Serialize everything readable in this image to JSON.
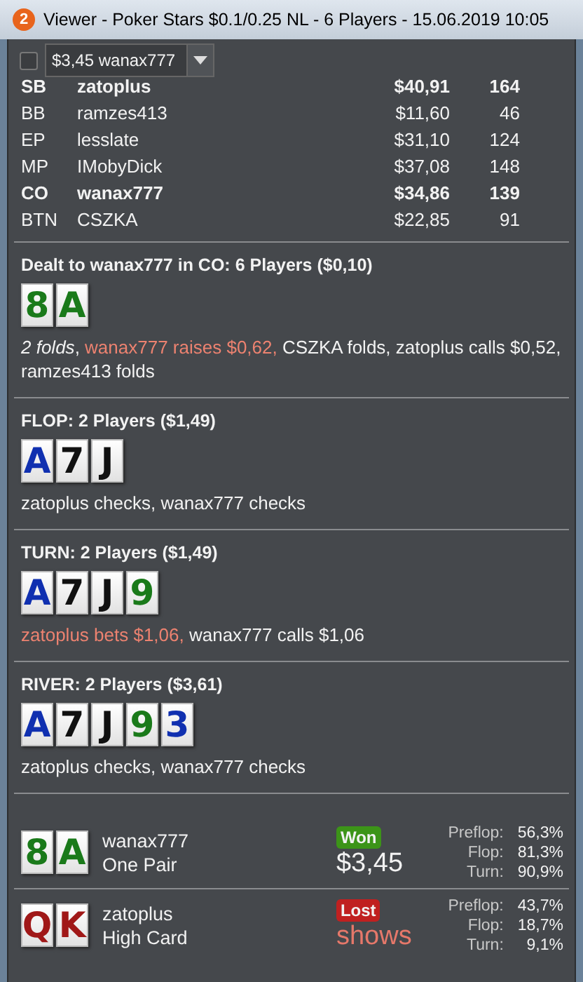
{
  "window": {
    "badge": "2",
    "title": "Viewer - Poker Stars $0.1/0.25 NL - 6 Players - 15.06.2019 10:05"
  },
  "toolbar": {
    "checkbox": {
      "checked": false
    },
    "dropdown": {
      "value": "$3,45 wanax777"
    }
  },
  "players": [
    {
      "position": "SB",
      "name": "zatoplus",
      "stack": "$40,91",
      "bb": "164",
      "highlighted": true
    },
    {
      "position": "BB",
      "name": "ramzes413",
      "stack": "$11,60",
      "bb": "46",
      "highlighted": false
    },
    {
      "position": "EP",
      "name": "lesslate",
      "stack": "$31,10",
      "bb": "124",
      "highlighted": false
    },
    {
      "position": "MP",
      "name": "IMobyDick",
      "stack": "$37,08",
      "bb": "148",
      "highlighted": false
    },
    {
      "position": "CO",
      "name": "wanax777",
      "stack": "$34,86",
      "bb": "139",
      "highlighted": true
    },
    {
      "position": "BTN",
      "name": "CSZKA",
      "stack": "$22,85",
      "bb": "91",
      "highlighted": false
    }
  ],
  "streets": [
    {
      "title": "Dealt to wanax777 in CO: 6 Players ($0,10)",
      "cards": [
        {
          "rank": "8",
          "color": "#1a7a1a"
        },
        {
          "rank": "A",
          "color": "#1a7a1a"
        }
      ],
      "actions": [
        {
          "kind": "folds",
          "text": "2 folds"
        },
        {
          "kind": "plain",
          "text": ", "
        },
        {
          "kind": "aggressive",
          "text": "wanax777 raises $0,62,"
        },
        {
          "kind": "plain",
          "text": " CSZKA folds, zatoplus calls $0,52, ramzes413 folds"
        }
      ]
    },
    {
      "title": "FLOP: 2 Players ($1,49)",
      "cards": [
        {
          "rank": "A",
          "color": "#1030b0"
        },
        {
          "rank": "7",
          "color": "#111111"
        },
        {
          "rank": "J",
          "color": "#111111"
        }
      ],
      "actions": [
        {
          "kind": "plain",
          "text": "zatoplus checks, wanax777 checks"
        }
      ]
    },
    {
      "title": "TURN: 2 Players ($1,49)",
      "cards": [
        {
          "rank": "A",
          "color": "#1030b0"
        },
        {
          "rank": "7",
          "color": "#111111"
        },
        {
          "rank": "J",
          "color": "#111111"
        },
        {
          "rank": "9",
          "color": "#1a7a1a"
        }
      ],
      "actions": [
        {
          "kind": "aggressive",
          "text": "zatoplus bets $1,06,"
        },
        {
          "kind": "plain",
          "text": " wanax777 calls $1,06"
        }
      ]
    },
    {
      "title": "RIVER: 2 Players ($3,61)",
      "cards": [
        {
          "rank": "A",
          "color": "#1030b0"
        },
        {
          "rank": "7",
          "color": "#111111"
        },
        {
          "rank": "J",
          "color": "#111111"
        },
        {
          "rank": "9",
          "color": "#1a7a1a"
        },
        {
          "rank": "3",
          "color": "#1030b0"
        }
      ],
      "actions": [
        {
          "kind": "plain",
          "text": "zatoplus checks, wanax777 checks"
        }
      ]
    }
  ],
  "showdown": [
    {
      "cards": [
        {
          "rank": "8",
          "color": "#1a7a1a"
        },
        {
          "rank": "A",
          "color": "#1a7a1a"
        }
      ],
      "name": "wanax777",
      "hand": "One Pair",
      "kind": "won",
      "badge": "Won",
      "amount": "$3,45",
      "equity": [
        {
          "label": "Preflop:",
          "value": "56,3%"
        },
        {
          "label": "Flop:",
          "value": "81,3%"
        },
        {
          "label": "Turn:",
          "value": "90,9%"
        }
      ]
    },
    {
      "cards": [
        {
          "rank": "Q",
          "color": "#a01818"
        },
        {
          "rank": "K",
          "color": "#a01818"
        }
      ],
      "name": "zatoplus",
      "hand": "High Card",
      "kind": "lost",
      "badge": "Lost",
      "amount": "shows",
      "equity": [
        {
          "label": "Preflop:",
          "value": "43,7%"
        },
        {
          "label": "Flop:",
          "value": "18,7%"
        },
        {
          "label": "Turn:",
          "value": "9,1%"
        }
      ]
    }
  ]
}
